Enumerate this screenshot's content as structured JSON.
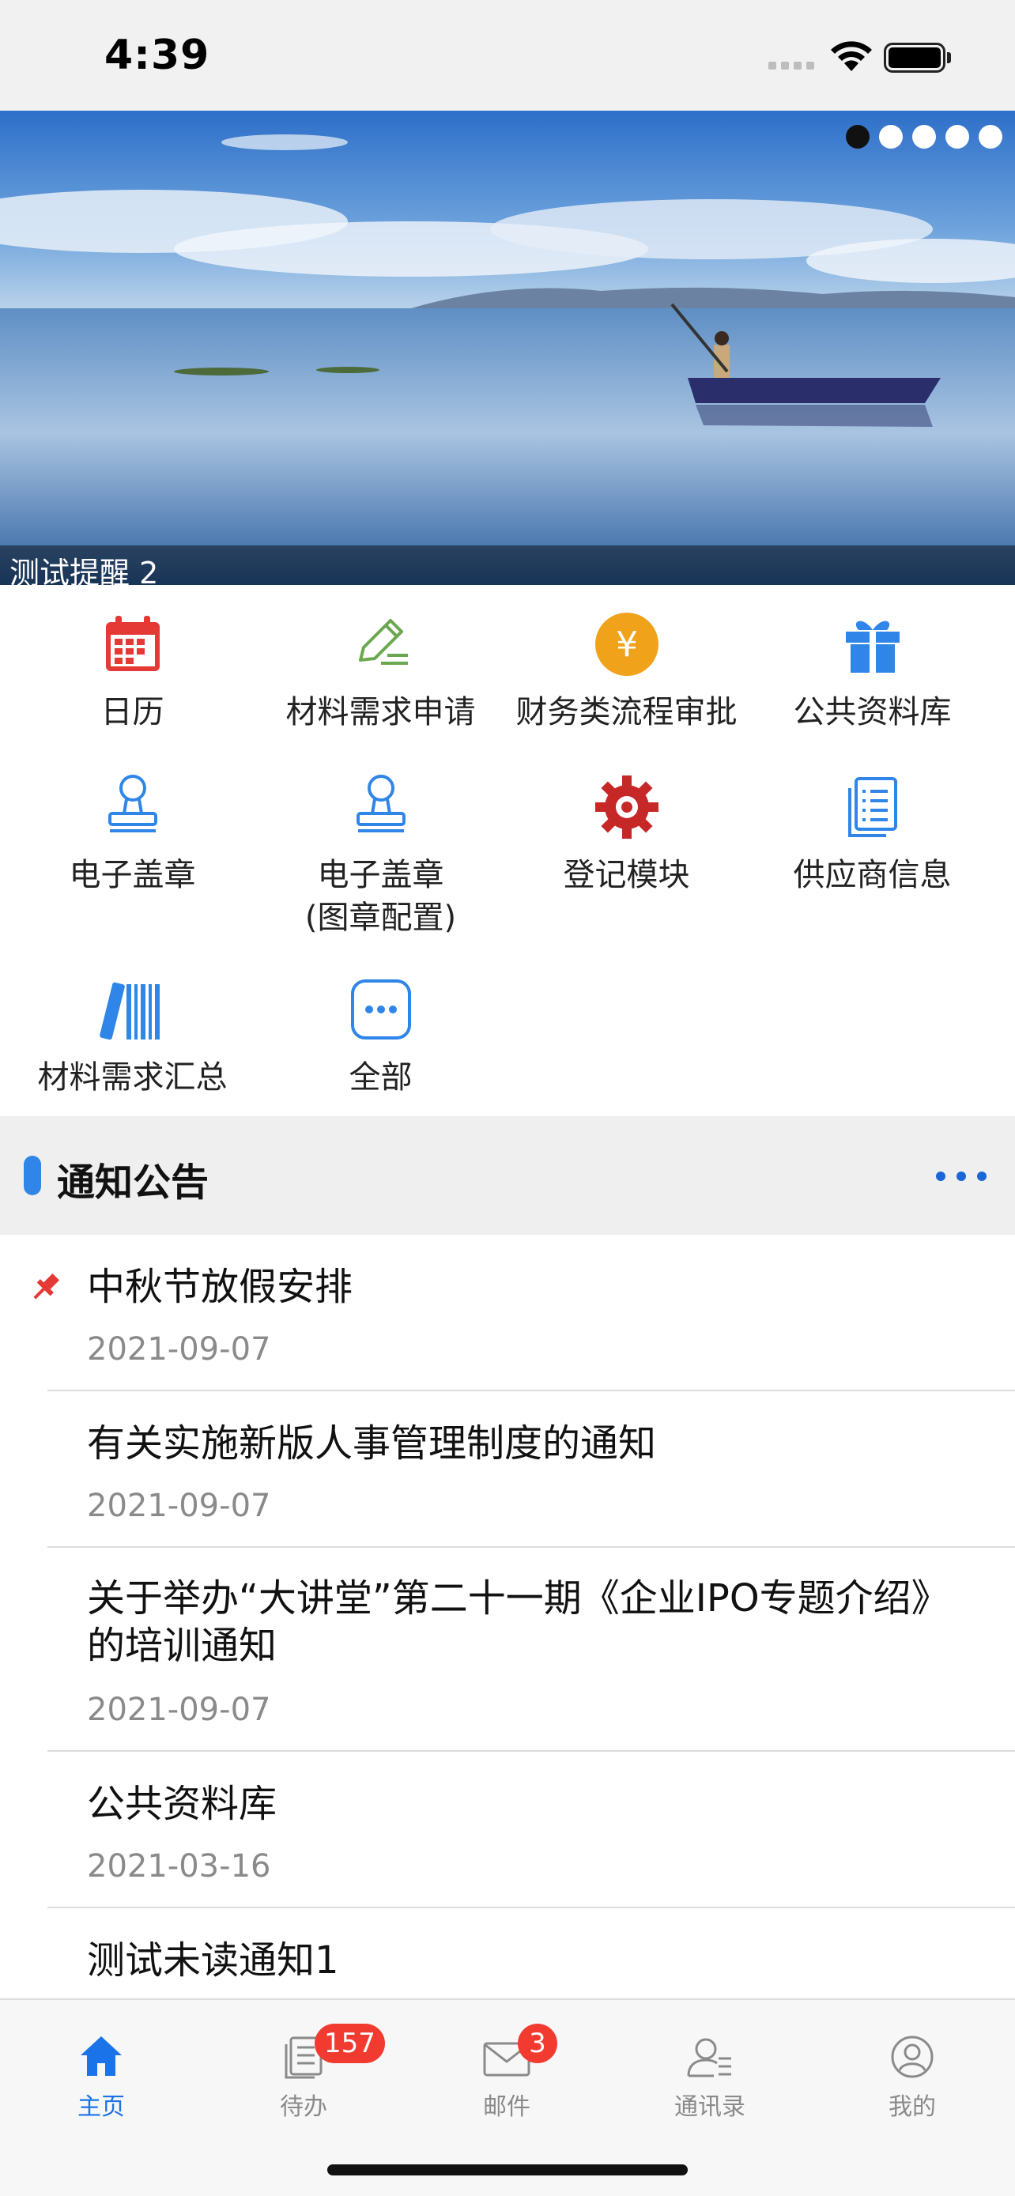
{
  "status_bar": {
    "time": "4:39"
  },
  "banner": {
    "caption": "测试提醒 2",
    "dots": [
      true,
      false,
      false,
      false,
      false
    ]
  },
  "apps": [
    {
      "label": "日历",
      "icon": "calendar-icon"
    },
    {
      "label": "材料需求申请",
      "icon": "pencil-icon"
    },
    {
      "label": "财务类流程审批",
      "icon": "yen-icon"
    },
    {
      "label": "公共资料库",
      "icon": "gift-icon"
    },
    {
      "label": "电子盖章",
      "icon": "stamp-icon"
    },
    {
      "label": "电子盖章\n(图章配置)",
      "icon": "stamp-icon"
    },
    {
      "label": "登记模块",
      "icon": "gear-icon"
    },
    {
      "label": "供应商信息",
      "icon": "document-icon"
    },
    {
      "label": "材料需求汇总",
      "icon": "books-icon"
    },
    {
      "label": "全部",
      "icon": "more-icon"
    }
  ],
  "section": {
    "title": "通知公告"
  },
  "notices": [
    {
      "title": "中秋节放假安排",
      "date": "2021-09-07",
      "pinned": true
    },
    {
      "title": "有关实施新版人事管理制度的通知",
      "date": "2021-09-07",
      "pinned": false
    },
    {
      "title": "关于举办“大讲堂”第二十一期《企业IPO专题介绍》的培训通知",
      "date": "2021-09-07",
      "pinned": false
    },
    {
      "title": "公共资料库",
      "date": "2021-03-16",
      "pinned": false
    },
    {
      "title": "测试未读通知1",
      "date": "",
      "pinned": false
    }
  ],
  "tabbar": {
    "items": [
      {
        "label": "主页",
        "icon": "home-icon",
        "active": true
      },
      {
        "label": "待办",
        "icon": "todo-icon",
        "badge": "157"
      },
      {
        "label": "邮件",
        "icon": "mail-icon",
        "badge": "3"
      },
      {
        "label": "通讯录",
        "icon": "contacts-icon"
      },
      {
        "label": "我的",
        "icon": "profile-icon"
      }
    ]
  },
  "colors": {
    "accent": "#1a73e8",
    "badge": "#f23b30",
    "calendar": "#e53935",
    "gear": "#c62828",
    "yen": "#f0a21b"
  }
}
